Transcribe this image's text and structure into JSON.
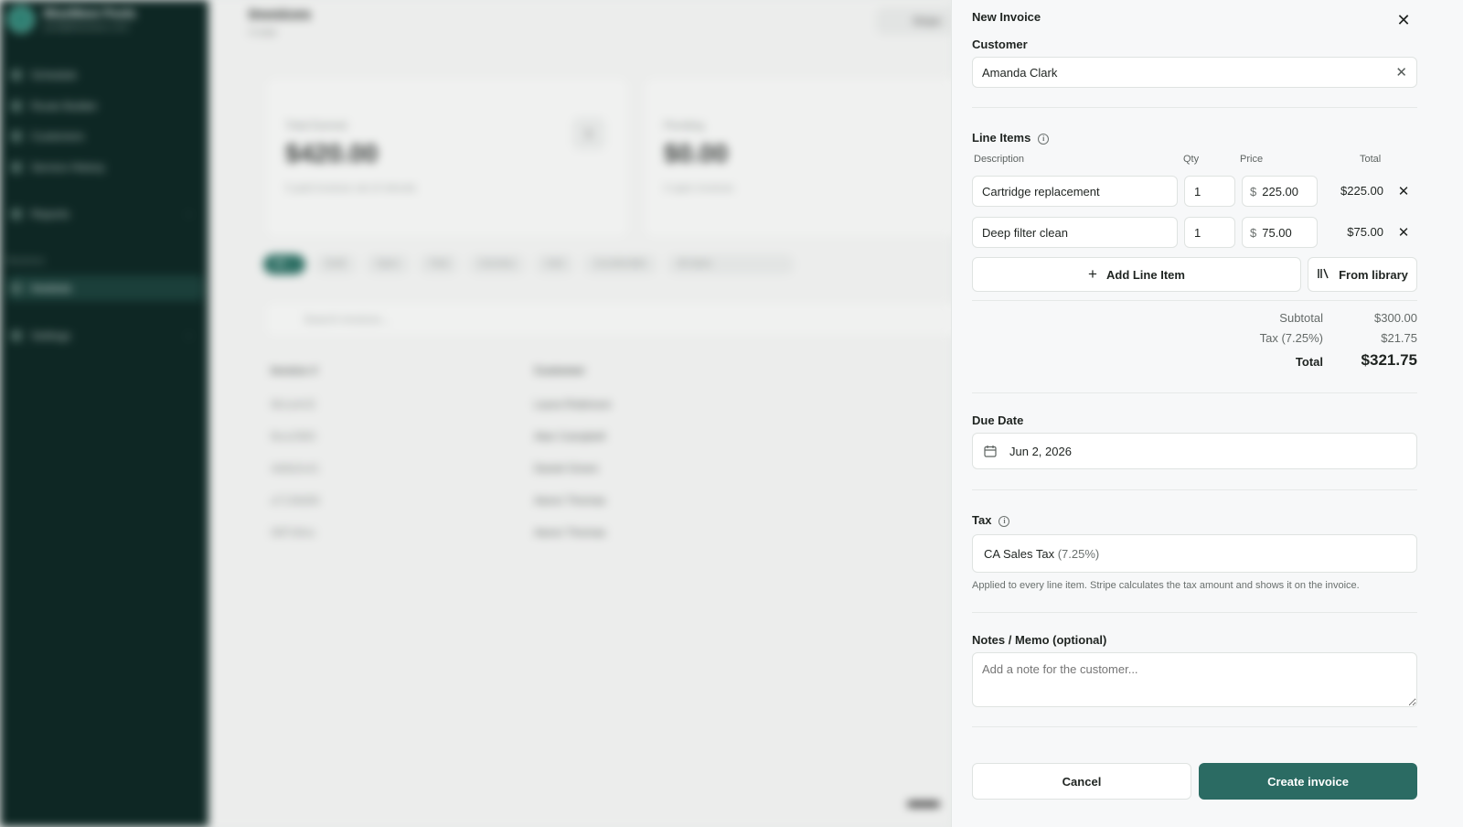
{
  "background": {
    "brand": {
      "name": "BlueWave Pools",
      "sub": "pool@bluewave.com"
    },
    "nav": [
      "Schedule",
      "Route Builder",
      "Customers",
      "Service History",
      "Reports"
    ],
    "nav_section": "Business",
    "nav_active": "Invoices",
    "nav_settings": "Settings",
    "page_title": "Invoices",
    "page_sub": "5 total",
    "header_button": "Stripe",
    "stats": [
      {
        "label": "Total Earned",
        "value": "$420.00",
        "note": "5 paid invoices net of refunds"
      },
      {
        "label": "Pending",
        "value": "$0.00",
        "note": "0 open invoices"
      }
    ],
    "filters": [
      "All",
      "Draft",
      "Open",
      "Paid",
      "Overdue",
      "Void",
      "Uncollectible",
      "All dates"
    ],
    "search_placeholder": "Search invoices...",
    "table_headers": [
      "Invoice #",
      "Customer"
    ],
    "rows": [
      {
        "id": "9b1a4cf2",
        "customer": "Laura Robinson"
      },
      {
        "id": "fbce2983",
        "customer": "Alan Campbell"
      },
      {
        "id": "4d8d2e41",
        "customer": "Daniel Green"
      },
      {
        "id": "a7136d58",
        "customer": "Aaron Thomas"
      },
      {
        "id": "08f7d0ec",
        "customer": "Aaron Thomas"
      }
    ]
  },
  "drawer": {
    "title": "New Invoice",
    "customer_label": "Customer",
    "customer_value": "Amanda Clark",
    "line_items_label": "Line Items",
    "columns": {
      "description": "Description",
      "qty": "Qty",
      "price": "Price",
      "total": "Total"
    },
    "currency_symbol": "$",
    "line_items": [
      {
        "description": "Cartridge replacement",
        "qty": "1",
        "price": "225.00",
        "total": "$225.00"
      },
      {
        "description": "Deep filter clean",
        "qty": "1",
        "price": "75.00",
        "total": "$75.00"
      }
    ],
    "add_line_item": "Add Line Item",
    "from_library": "From library",
    "subtotal_label": "Subtotal",
    "subtotal_value": "$300.00",
    "tax_label": "Tax (7.25%)",
    "tax_value": "$21.75",
    "total_label": "Total",
    "total_value": "$321.75",
    "due_date_label": "Due Date",
    "due_date_value": "Jun 2, 2026",
    "tax_section_label": "Tax",
    "tax_name": "CA Sales Tax",
    "tax_rate": "(7.25%)",
    "tax_hint": "Applied to every line item. Stripe calculates the tax amount and shows it on the invoice.",
    "notes_label": "Notes / Memo (optional)",
    "notes_placeholder": "Add a note for the customer...",
    "cancel": "Cancel",
    "create": "Create invoice"
  },
  "colors": {
    "primary": "#2b6b63",
    "sidebar": "#0e2724"
  }
}
